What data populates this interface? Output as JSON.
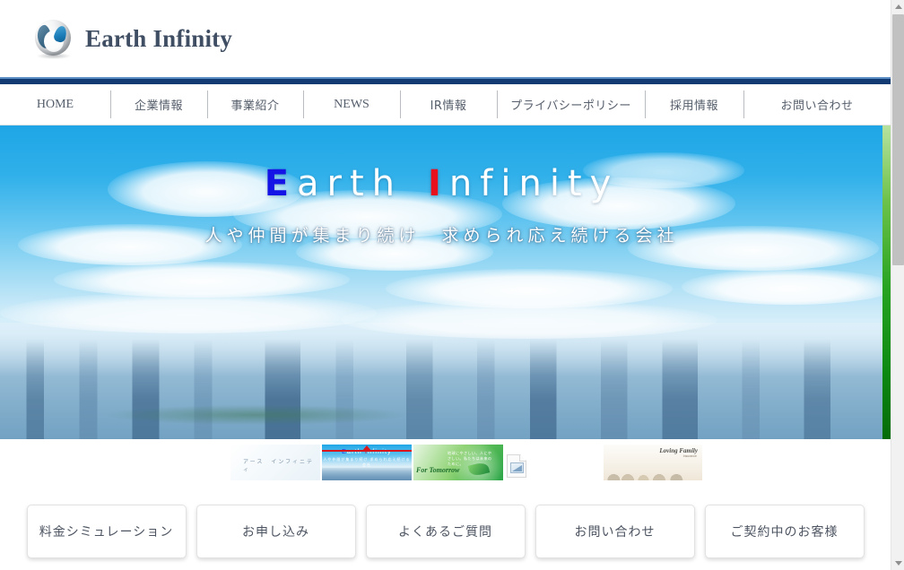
{
  "site": {
    "logo_text": "Earth Infinity",
    "logo_icon": "sphere-droplet-logo"
  },
  "nav": {
    "items": [
      {
        "label": "HOME",
        "icon": "nav-item",
        "jp": false
      },
      {
        "label": "企業情報",
        "icon": "nav-item",
        "jp": true
      },
      {
        "label": "事業紹介",
        "icon": "nav-item",
        "jp": true
      },
      {
        "label": "NEWS",
        "icon": "nav-item",
        "jp": false
      },
      {
        "label": "IR情報",
        "icon": "nav-item",
        "jp": true
      },
      {
        "label": "プライバシーポリシー",
        "icon": "nav-item",
        "jp": true
      },
      {
        "label": "採用情報",
        "icon": "nav-item",
        "jp": true
      },
      {
        "label": "お問い合わせ",
        "icon": "nav-item",
        "jp": true
      }
    ]
  },
  "hero": {
    "title_part1": "E",
    "title_part2": "arth",
    "title_part3": "I",
    "title_part4": "nfinity",
    "title_full": "Earth Infinity",
    "subtitle": "人や仲間が集まり続け　求められ応え続ける会社",
    "accent_blue": "#1414e6",
    "accent_red": "#e8101d",
    "next_slide_color": "#27a321"
  },
  "carousel": {
    "active_index": 1,
    "marker_color": "#d8161e",
    "thumbs": [
      {
        "name": "thumb-white-earth-infinity",
        "caption": "アース　インフィニティ",
        "kind": "white"
      },
      {
        "name": "thumb-sky-city",
        "caption": "Earth Infinity",
        "sub": "人や仲間が集まり続け 求められ応え続ける会社",
        "kind": "sky",
        "active": true
      },
      {
        "name": "thumb-green-for-tomorrow",
        "caption": "For Tomorrow",
        "sub": "地球にやさしい、人にやさしい。私たちは未来のために。",
        "kind": "green"
      },
      {
        "name": "thumb-broken-image",
        "caption": "",
        "kind": "broken"
      },
      {
        "name": "thumb-loving-family",
        "caption": "Loving Family",
        "sub": "Insurance",
        "kind": "family"
      }
    ]
  },
  "quick_buttons": [
    {
      "label": "料金シミュレーション",
      "name": "fee-simulation-button"
    },
    {
      "label": "お申し込み",
      "name": "application-button"
    },
    {
      "label": "よくあるご質問",
      "name": "faq-button"
    },
    {
      "label": "お問い合わせ",
      "name": "contact-button"
    },
    {
      "label": "ご契約中のお客様",
      "name": "existing-customer-button"
    }
  ],
  "scrollbar": {
    "up_icon": "chevron-up-icon",
    "down_icon": "chevron-down-icon"
  }
}
